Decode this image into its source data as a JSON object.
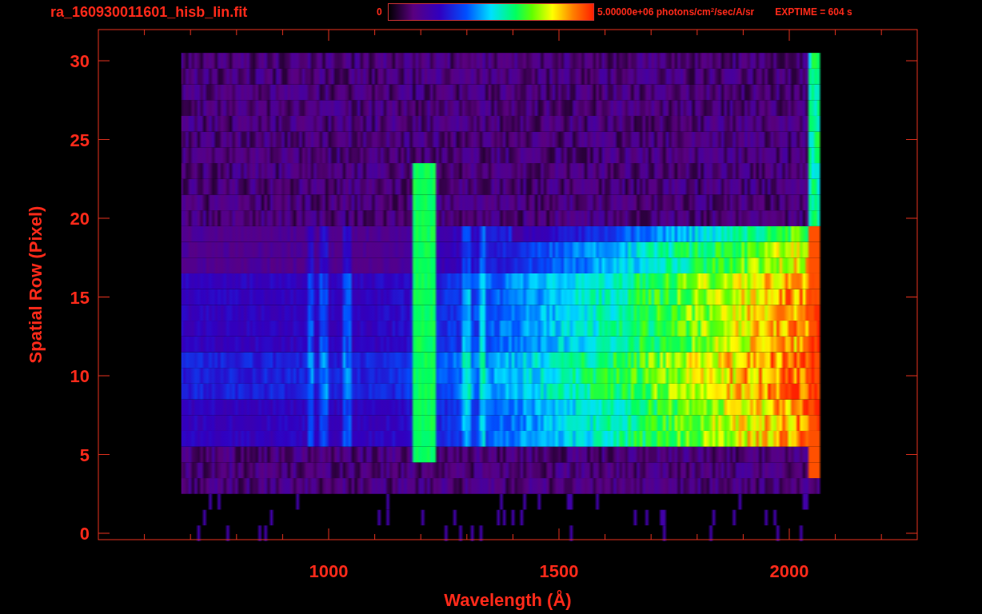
{
  "title": "ra_160930011601_hisb_lin.fit",
  "colorbar": {
    "min_label": "0",
    "max_label": "5.00000e+06 photons/cm$^{2}$/sec/A/sr"
  },
  "exposure": "EXPTIME = 604 s",
  "x_axis": {
    "label": "Wavelength (Å)",
    "ticks": [
      "1000",
      "1500",
      "2000"
    ]
  },
  "y_axis": {
    "label": "Spatial Row (Pixel)",
    "ticks": [
      "30",
      "25",
      "20",
      "15",
      "10",
      "5",
      "0"
    ]
  }
}
